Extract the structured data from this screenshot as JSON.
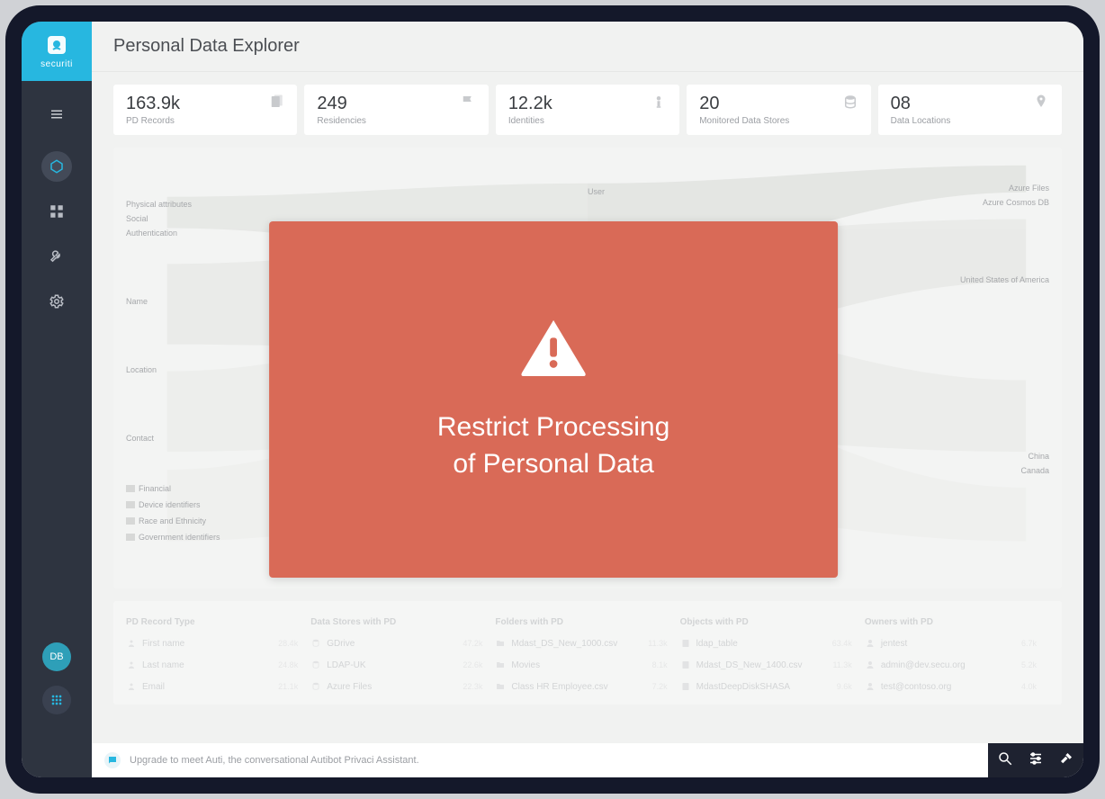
{
  "brand": {
    "name": "securiti"
  },
  "header": {
    "title": "Personal Data Explorer"
  },
  "metrics": [
    {
      "value": "163.9k",
      "label": "PD Records",
      "icon": "records-icon"
    },
    {
      "value": "249",
      "label": "Residencies",
      "icon": "flag-icon"
    },
    {
      "value": "12.2k",
      "label": "Identities",
      "icon": "person-icon"
    },
    {
      "value": "20",
      "label": "Monitored Data Stores",
      "icon": "database-icon"
    },
    {
      "value": "08",
      "label": "Data Locations",
      "icon": "pin-icon"
    }
  ],
  "viz": {
    "left_labels": [
      "Physical attributes",
      "Social",
      "Authentication",
      "Name",
      "Location",
      "Contact",
      "Financial",
      "Device identifiers",
      "Race and Ethnicity",
      "Government identifiers"
    ],
    "center_label": "User",
    "right_labels_top": [
      "Azure Files",
      "Azure Cosmos DB"
    ],
    "right_labels_mid": [
      "United States of America"
    ],
    "right_labels_low": [
      "China",
      "Canada"
    ]
  },
  "table": {
    "headers": [
      "PD Record Type",
      "",
      "Data Stores with PD",
      "",
      "Folders with PD",
      "",
      "Objects with PD",
      "",
      "Owners with PD",
      ""
    ],
    "rows": [
      [
        "First name",
        "28.4k",
        "GDrive",
        "47.2k",
        "Mdast_DS_New_1000.csv",
        "11.3k",
        "ldap_table",
        "63.4k",
        "jentest",
        "6.7k"
      ],
      [
        "Last name",
        "24.8k",
        "LDAP-UK",
        "22.6k",
        "Movies",
        "8.1k",
        "Mdast_DS_New_1400.csv",
        "11.3k",
        "admin@dev.secu.org",
        "5.2k"
      ],
      [
        "Email",
        "21.1k",
        "Azure Files",
        "22.3k",
        "Class HR Employee.csv",
        "7.2k",
        "MdastDeepDiskSHASA",
        "9.6k",
        "test@contoso.org",
        "4.0k"
      ]
    ]
  },
  "footer": {
    "text": "Upgrade to meet Auti, the conversational Autibot Privaci Assistant."
  },
  "sidebar": {
    "avatar_initials": "DB"
  },
  "modal": {
    "line1": "Restrict Processing",
    "line2": "of Personal Data"
  }
}
